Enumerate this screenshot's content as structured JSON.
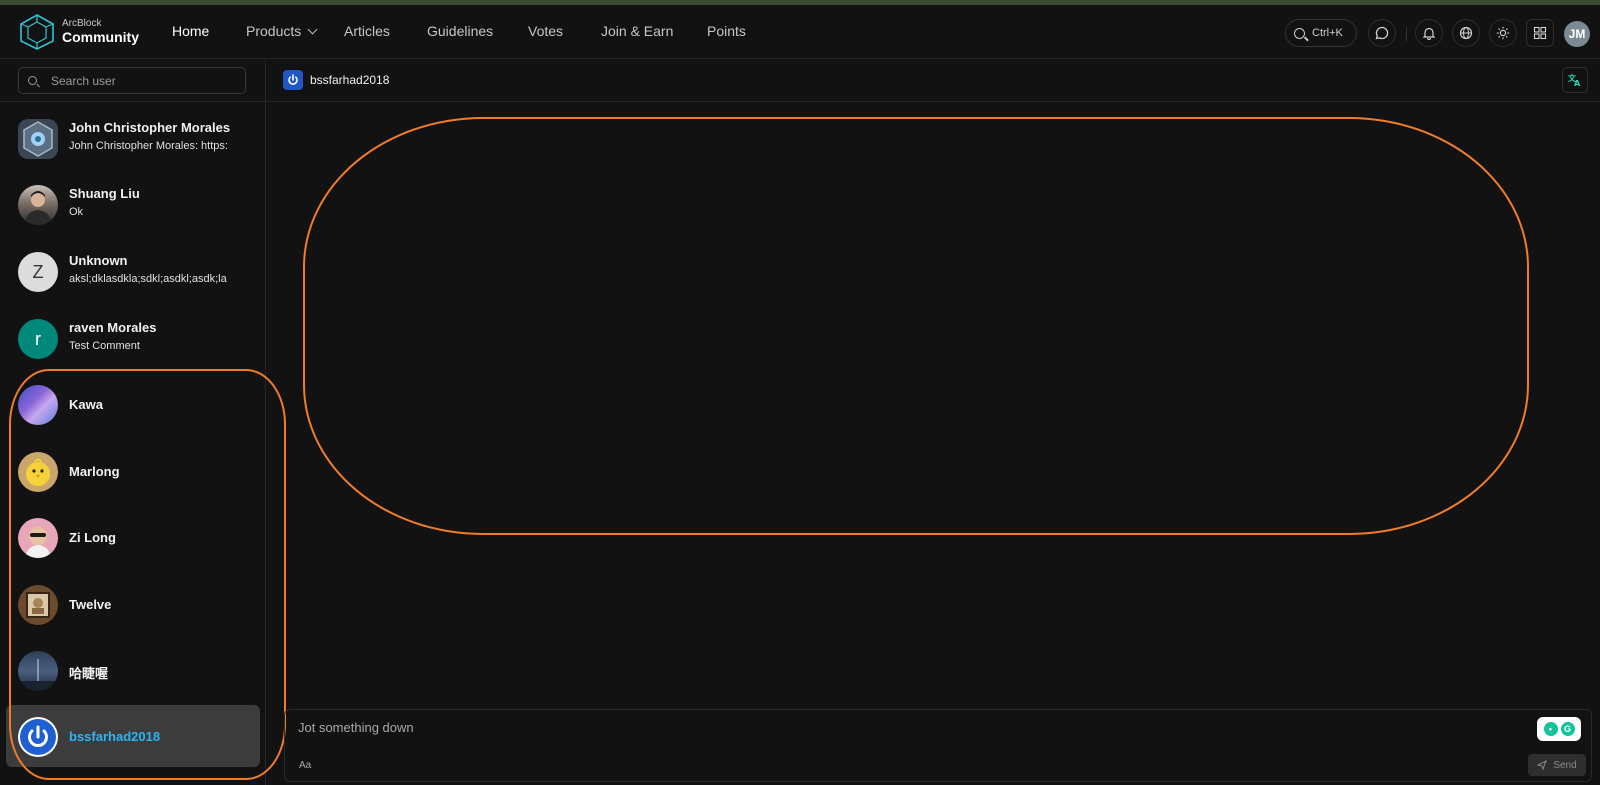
{
  "brand": {
    "line1": "ArcBlock",
    "line2": "Community",
    "icon": "arcblock-logo-icon"
  },
  "nav": {
    "items": [
      {
        "label": "Home",
        "active": true
      },
      {
        "label": "Products",
        "has_dropdown": true
      },
      {
        "label": "Articles"
      },
      {
        "label": "Guidelines"
      },
      {
        "label": "Votes"
      },
      {
        "label": "Join & Earn"
      },
      {
        "label": "Points"
      }
    ]
  },
  "header_actions": {
    "search_shortcut": "Ctrl+K",
    "icons": [
      "search-icon",
      "chat-icon",
      "bell-icon",
      "globe-icon",
      "sun-icon",
      "apps-grid-icon"
    ],
    "user_initials": "JM"
  },
  "sidebar": {
    "search_placeholder": "Search user",
    "contacts": [
      {
        "name": "John Christopher Morales",
        "last_message": "John Christopher Morales: https:",
        "avatar": "badge"
      },
      {
        "name": "Shuang Liu",
        "last_message": "Ok",
        "avatar": "photo"
      },
      {
        "name": "Unknown",
        "last_message": "aksl;dklasdkla;sdkl;asdkl;asdk;la",
        "avatar_letter": "Z"
      },
      {
        "name": "raven Morales",
        "last_message": "Test Comment",
        "avatar_letter": "r"
      },
      {
        "name": "Kawa",
        "last_message": "",
        "avatar": "photo"
      },
      {
        "name": "Marlong",
        "last_message": "",
        "avatar": "photo"
      },
      {
        "name": "Zi Long",
        "last_message": "",
        "avatar": "photo"
      },
      {
        "name": "Twelve",
        "last_message": "",
        "avatar": "photo"
      },
      {
        "name": "哈睫喔",
        "last_message": "",
        "avatar": "photo"
      },
      {
        "name": "bssfarhad2018",
        "last_message": "",
        "avatar": "power",
        "selected": true
      }
    ]
  },
  "chat": {
    "title": "bssfarhad2018",
    "translate_icon": "translate-icon"
  },
  "composer": {
    "placeholder": "Jot something down",
    "format_label": "Aa",
    "send_label": "Send"
  },
  "colors": {
    "accent": "#29b6f6",
    "annotation": "#f07c2a",
    "background": "#121212"
  }
}
